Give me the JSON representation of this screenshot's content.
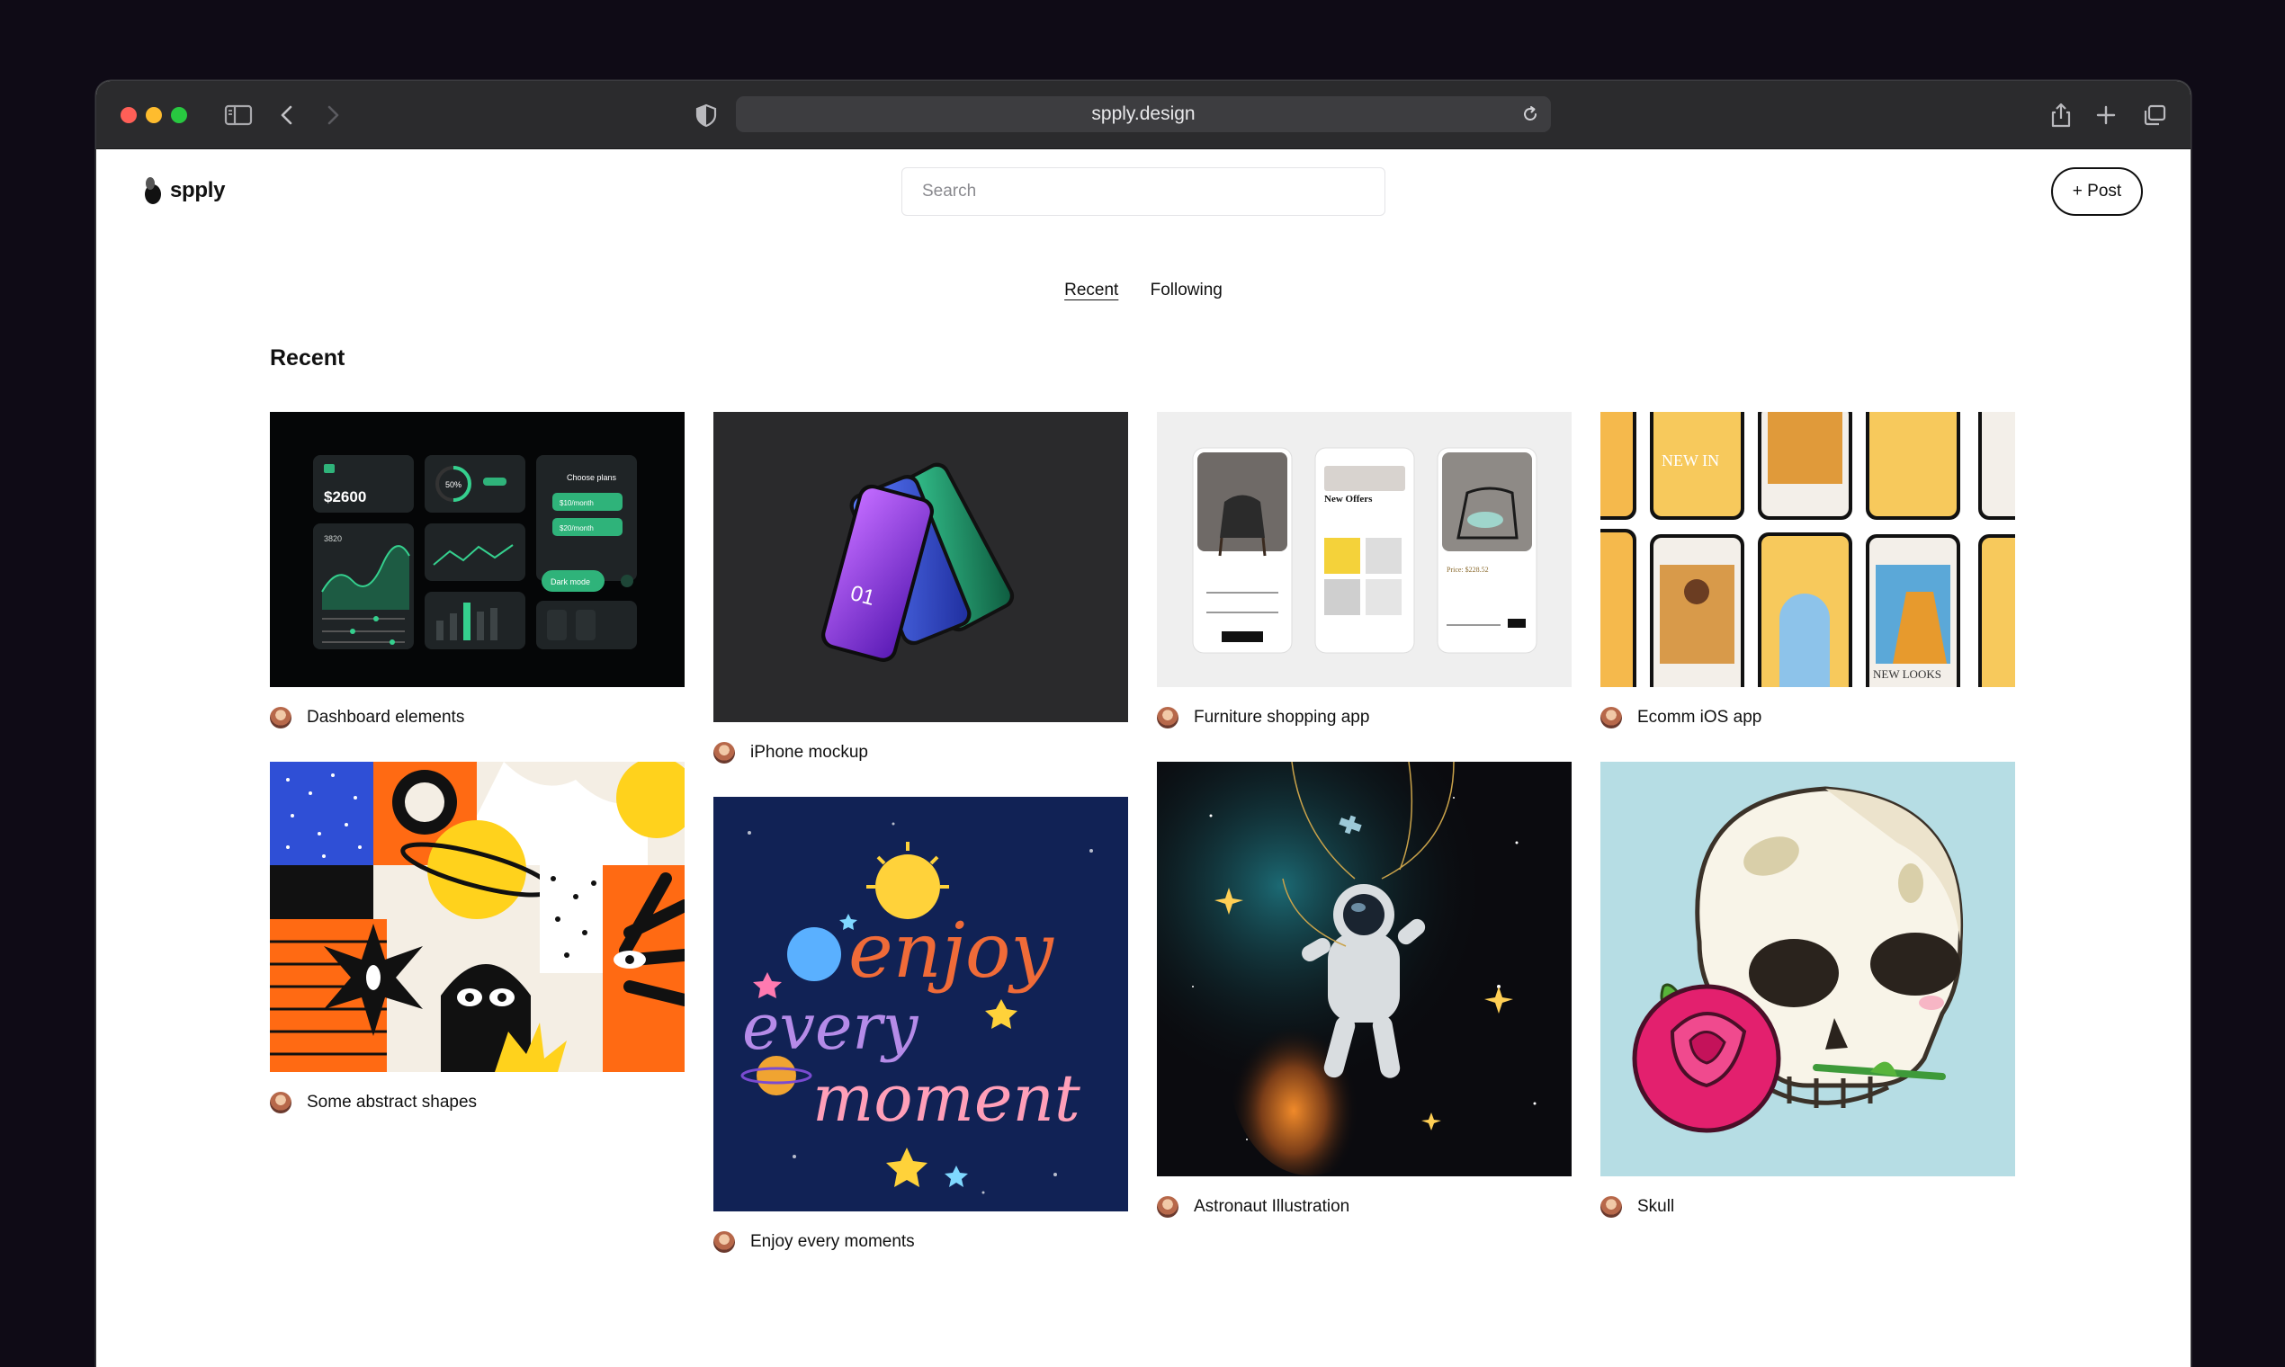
{
  "browser": {
    "url": "spply.design"
  },
  "header": {
    "logo_text": "spply",
    "search_placeholder": "Search",
    "post_label": "+ Post"
  },
  "tabs": [
    {
      "label": "Recent",
      "active": true
    },
    {
      "label": "Following",
      "active": false
    }
  ],
  "section_title": "Recent",
  "cards": [
    {
      "title": "Dashboard elements"
    },
    {
      "title": "iPhone mockup"
    },
    {
      "title": "Furniture shopping app"
    },
    {
      "title": "Ecomm iOS app"
    },
    {
      "title": "Some abstract shapes"
    },
    {
      "title": "Enjoy every moments"
    },
    {
      "title": "Astronaut Illustration"
    },
    {
      "title": "Skull"
    }
  ],
  "artwork_text": {
    "dashboard_amount": "$2600",
    "dashboard_percent": "50%",
    "dashboard_plans": "Choose plans",
    "dashboard_price1": "$10/month",
    "dashboard_price2": "$20/month",
    "dashboard_mode": "Dark mode",
    "dashboard_count": "3820",
    "iphone_number": "01",
    "furniture_heading": "New Offers",
    "furniture_price": "Price: $228.52",
    "ecomm_newin": "NEW IN",
    "ecomm_newlooks": "NEW LOOKS",
    "lettering_1": "enjoy",
    "lettering_2": "every",
    "lettering_3": "moment"
  },
  "colors": {
    "accent_green": "#2fb37a",
    "page_bg": "#0f0b16",
    "toolbar": "#2b2b2d"
  }
}
